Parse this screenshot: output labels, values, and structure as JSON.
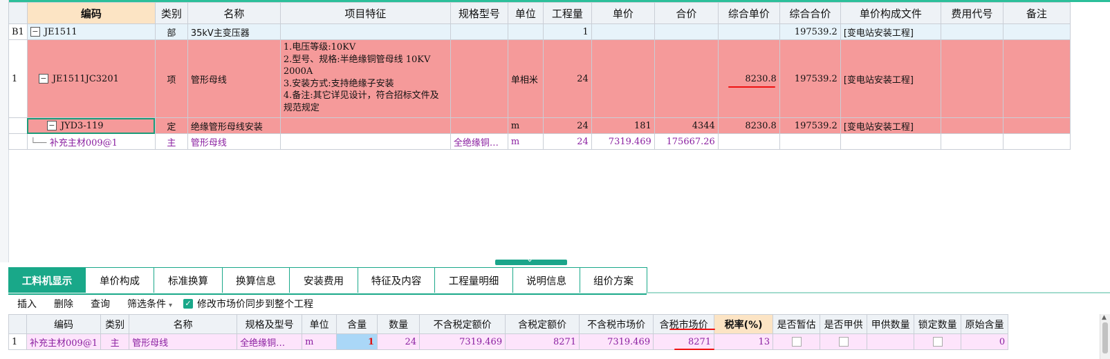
{
  "upper": {
    "headers": [
      "编码",
      "类别",
      "名称",
      "项目特征",
      "规格型号",
      "单位",
      "工程量",
      "单价",
      "合价",
      "综合单价",
      "综合合价",
      "单价构成文件",
      "费用代号",
      "备注"
    ],
    "row_b1": {
      "rn": "B1",
      "code": "JE1511",
      "type": "部",
      "name": "35kV主变压器",
      "feature": "",
      "spec": "",
      "unit": "",
      "qty": "1",
      "price": "",
      "total": "",
      "cprice": "",
      "ctotal": "197539.2",
      "file": "[变电站安装工程]",
      "fee": "",
      "note": ""
    },
    "row_1": {
      "rn": "1",
      "code": "JE1511JC3201",
      "type": "项",
      "name": "管形母线",
      "feature_lines": [
        "1.电压等级:10KV",
        "2.型号、规格:半绝缘铜管母线 10KV 2000A",
        "3.安装方式:支持绝缘子安装",
        "4.备注:其它详见设计，符合招标文件及规范规定"
      ],
      "spec": "",
      "unit": "单相米",
      "qty": "24",
      "price": "",
      "total": "",
      "cprice": "8230.8",
      "ctotal": "197539.2",
      "file": "[变电站安装工程]",
      "fee": "",
      "note": ""
    },
    "row_def": {
      "rn": "",
      "code": "JYD3-119",
      "type": "定",
      "name": "绝缘管形母线安装",
      "feature": "",
      "spec": "",
      "unit": "m",
      "qty": "24",
      "price": "181",
      "total": "4344",
      "cprice": "8230.8",
      "ctotal": "197539.2",
      "file": "[变电站安装工程]",
      "fee": "",
      "note": ""
    },
    "row_main": {
      "rn": "",
      "code": "补充主材009@1",
      "type": "主",
      "name": "管形母线",
      "feature": "",
      "spec": "全绝缘铜…",
      "unit": "m",
      "qty": "24",
      "price": "7319.469",
      "total": "175667.26",
      "cprice": "",
      "ctotal": "",
      "file": "",
      "fee": "",
      "note": ""
    }
  },
  "tabs": [
    "工料机显示",
    "单价构成",
    "标准换算",
    "换算信息",
    "安装费用",
    "特征及内容",
    "工程量明细",
    "说明信息",
    "组价方案"
  ],
  "toolbar": {
    "insert": "插入",
    "delete": "删除",
    "query": "查询",
    "filter": "筛选条件",
    "sync_label": "修改市场价同步到整个工程"
  },
  "lower": {
    "headers": [
      "编码",
      "类别",
      "名称",
      "规格及型号",
      "单位",
      "含量",
      "数量",
      "不含税定额价",
      "含税定额价",
      "不含税市场价",
      "含税市场价",
      "税率(%)",
      "是否暂估",
      "是否甲供",
      "甲供数量",
      "锁定数量",
      "原始含量"
    ],
    "row": {
      "rn": "1",
      "code": "补充主材009@1",
      "type": "主",
      "name": "管形母线",
      "spec": "全绝缘铜…",
      "unit": "m",
      "content": "1",
      "qty": "24",
      "ex_quota": "7319.469",
      "in_quota": "8271",
      "ex_market": "7319.469",
      "in_market": "8271",
      "tax": "13",
      "est": "",
      "jia": "",
      "jia_qty": "",
      "lock": "",
      "orig": "0"
    }
  },
  "colors": {
    "accent": "#19a889",
    "highlight_row": "#f59a9a",
    "material_row": "#fde4fb",
    "annotation": "#e11111"
  }
}
